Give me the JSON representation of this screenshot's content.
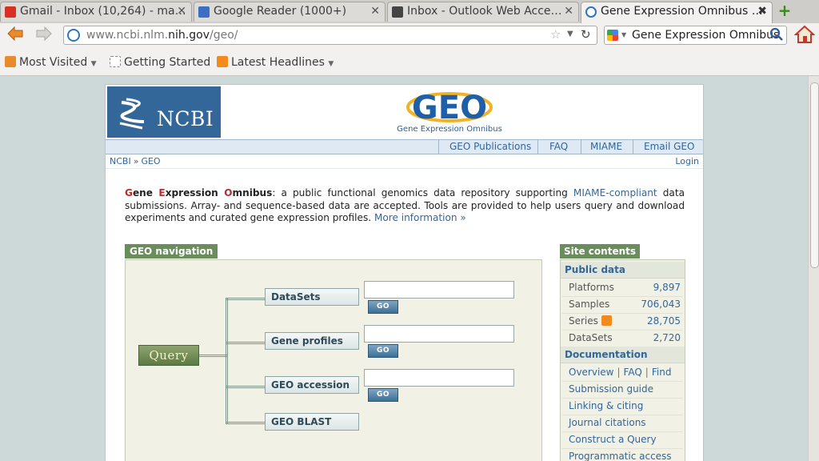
{
  "tabs": [
    {
      "label": "Gmail - Inbox (10,264) - ma…",
      "favicon_color": "#d93025"
    },
    {
      "label": "Google Reader (1000+)",
      "favicon_color": "#3b6fc4"
    },
    {
      "label": "Inbox - Outlook Web Acce…",
      "favicon_color": "#444444"
    },
    {
      "label": "Gene Expression Omnibus …",
      "favicon_color": "#2a75c4",
      "active": true
    }
  ],
  "new_tab_label": "+",
  "address": {
    "prefix": "www.ncbi.nlm.",
    "domain": "nih.gov",
    "suffix": "/geo/"
  },
  "search": {
    "value": "Gene Expression Omnibus"
  },
  "bookmarks": {
    "most_visited": "Most Visited",
    "getting_started": "Getting Started",
    "latest_headlines": "Latest Headlines"
  },
  "header": {
    "ncbi_logo": "NCBI",
    "geo_logo": "GEO",
    "geo_subtitle": "Gene Expression Omnibus"
  },
  "topnav": {
    "publications": "GEO Publications",
    "faq": "FAQ",
    "miame": "MIAME",
    "email": "Email GEO"
  },
  "breadcrumb": {
    "root": "NCBI",
    "sep": "»",
    "current": "GEO",
    "login": "Login"
  },
  "intro": {
    "g": "G",
    "ene": "ene ",
    "e": "E",
    "xpression": "xpression ",
    "o": "O",
    "mnibus": "mnibus",
    "text1": ": a public functional genomics data repository supporting ",
    "miame_link": "MIAME-compliant",
    "text2": " data submissions. Array- and sequence-based data are accepted. Tools are provided to help users query and download experiments and curated gene expression profiles. ",
    "more_link": "More information »"
  },
  "geo_nav": {
    "title": "GEO navigation",
    "query": "Query",
    "items": [
      "DataSets",
      "Gene profiles",
      "GEO accession",
      "GEO BLAST"
    ],
    "go": "GO"
  },
  "site_contents": {
    "title": "Site contents",
    "public_data": "Public data",
    "stats": [
      {
        "label": "Platforms",
        "value": "9,897"
      },
      {
        "label": "Samples",
        "value": "706,043"
      },
      {
        "label": "Series",
        "value": "28,705"
      },
      {
        "label": "DataSets",
        "value": "2,720"
      }
    ],
    "documentation": "Documentation",
    "overview": "Overview",
    "faq": "FAQ",
    "find": "Find",
    "links": [
      "Submission guide",
      "Linking & citing",
      "Journal citations",
      "Construct a Query",
      "Programmatic access"
    ]
  }
}
